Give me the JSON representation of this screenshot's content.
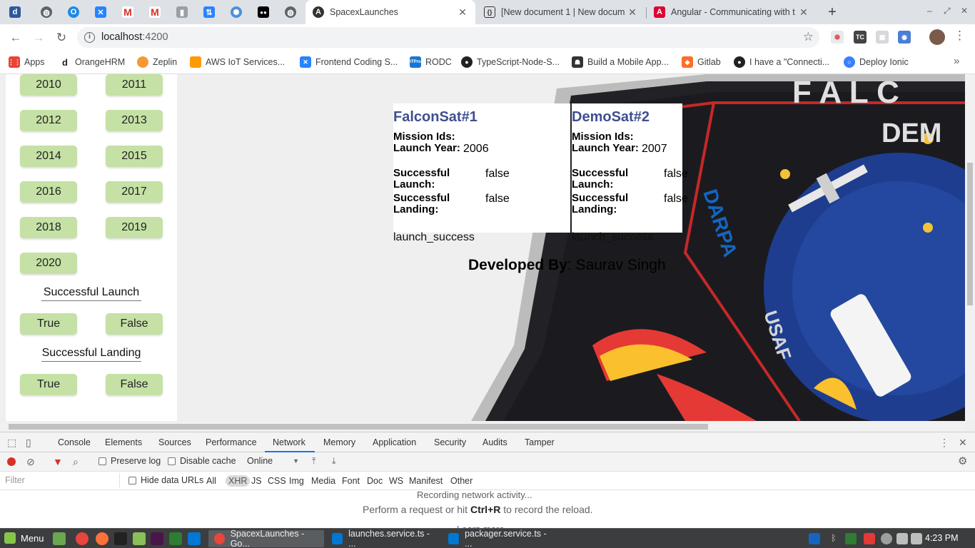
{
  "pinned_tabs": [
    {
      "icon": "dailyhunt-icon",
      "glyph": "d",
      "color": "#2b5a9c"
    },
    {
      "icon": "globe-icon",
      "glyph": "◍",
      "color": "#5f6368"
    },
    {
      "icon": "circle-o-icon",
      "glyph": "O",
      "color": "#1e88e5"
    },
    {
      "icon": "confluence-icon",
      "glyph": "✕",
      "color": "#2684ff"
    },
    {
      "icon": "gmail-icon",
      "glyph": "M",
      "color": "#d93025"
    },
    {
      "icon": "gmail-icon",
      "glyph": "M",
      "color": "#d93025"
    },
    {
      "icon": "trash-icon",
      "glyph": "▮",
      "color": "#9aa0a6"
    },
    {
      "icon": "jira-icon",
      "glyph": "⇅",
      "color": "#2684ff"
    },
    {
      "icon": "extension-icon",
      "glyph": "✺",
      "color": "#4a90d9"
    },
    {
      "icon": "medium-icon",
      "glyph": "●●",
      "color": "#000000"
    },
    {
      "icon": "globe-icon",
      "glyph": "◍",
      "color": "#5f6368"
    }
  ],
  "tabs": [
    {
      "title": "SpacexLaunches",
      "icon": "angular-icon",
      "active": true
    },
    {
      "title": "[New document 1 | New docum",
      "icon": "json-icon",
      "active": false
    },
    {
      "title": "Angular - Communicating with t",
      "icon": "angular-icon",
      "active": false
    }
  ],
  "omnibox": {
    "host": "localhost",
    "port": ":4200"
  },
  "bookmarks": [
    {
      "label": "Apps",
      "icon": "apps-grid-icon",
      "color": "#ea4335"
    },
    {
      "label": "OrangeHRM",
      "icon": "orangehrm-icon",
      "color": "#222222"
    },
    {
      "label": "Zeplin",
      "icon": "zeplin-icon",
      "color": "#f69833"
    },
    {
      "label": "AWS IoT Services...",
      "icon": "aws-cube-icon",
      "color": "#ff9900"
    },
    {
      "label": "Frontend Coding S...",
      "icon": "confluence-icon",
      "color": "#2684ff"
    },
    {
      "label": "RODC",
      "icon": "itpro-icon",
      "color": "#1976d2"
    },
    {
      "label": "TypeScript-Node-S...",
      "icon": "github-icon",
      "color": "#222222"
    },
    {
      "label": "Build a Mobile App...",
      "icon": "robot-icon",
      "color": "#333333"
    },
    {
      "label": "Gitlab",
      "icon": "gitlab-icon",
      "color": "#fc6d26"
    },
    {
      "label": "I have a \"Connecti...",
      "icon": "github-icon",
      "color": "#222222"
    },
    {
      "label": "Deploy Ionic",
      "icon": "ionic-icon",
      "color": "#3880ff"
    }
  ],
  "filters": {
    "years": [
      "2010",
      "2011",
      "2012",
      "2013",
      "2014",
      "2015",
      "2016",
      "2017",
      "2018",
      "2019",
      "2020"
    ],
    "launch_heading": "Successful Launch",
    "landing_heading": "Successful Landing",
    "true_label": "True",
    "false_label": "False"
  },
  "cards": [
    {
      "mission_name": "FalconSat#1",
      "mission_ids_label": "Mission Ids:",
      "launch_year_label": "Launch Year:",
      "launch_year": "2006",
      "launch_label_1": "Successful",
      "launch_label_2": "Launch:",
      "launch_value": "false",
      "landing_label_1": "Successful",
      "landing_label_2": "Landing:",
      "landing_value": "false",
      "footer": "launch_success"
    },
    {
      "mission_name": "DemoSat#2",
      "mission_ids_label": "Mission Ids:",
      "launch_year_label": "Launch Year:",
      "launch_year": "2007",
      "launch_label_1": "Successful",
      "launch_label_2": "Launch:",
      "launch_value": "false",
      "landing_label_1": "Successful",
      "landing_label_2": "Landing:",
      "landing_value": "false",
      "footer": "launch_success"
    }
  ],
  "footer": {
    "developed_label": "Developed By",
    "developer": ": Saurav Singh"
  },
  "devtools": {
    "tabs": [
      "Console",
      "Elements",
      "Sources",
      "Performance",
      "Network",
      "Memory",
      "Application",
      "Security",
      "Audits",
      "Tamper"
    ],
    "active_tab": "Network",
    "preserve_log": "Preserve log",
    "disable_cache": "Disable cache",
    "throttle": "Online",
    "filter_placeholder": "Filter",
    "hide_data_urls": "Hide data URLs",
    "filter_types": [
      "All",
      "XHR",
      "JS",
      "CSS",
      "Img",
      "Media",
      "Font",
      "Doc",
      "WS",
      "Manifest",
      "Other"
    ],
    "selected_type": "XHR",
    "msg_recording": "Recording network activity...",
    "msg_prefix": "Perform a request or hit ",
    "msg_shortcut": "Ctrl+R",
    "msg_suffix": " to record the reload.",
    "learn_more": "Learn more"
  },
  "taskbar": {
    "menu_label": "Menu",
    "windows": [
      {
        "title": "SpacexLaunches - Go...",
        "icon": "chrome-icon",
        "active": true
      },
      {
        "title": "launches.service.ts - ...",
        "icon": "vscode-icon",
        "active": false
      },
      {
        "title": "packager.service.ts - ...",
        "icon": "vscode-icon",
        "active": false
      }
    ],
    "clock": "4:23 PM"
  },
  "colors": {
    "year_button": "#c5e1a5",
    "mission_title": "#3f4f8f",
    "record_red": "#d93025",
    "devtools_accent": "#1a73e8"
  }
}
